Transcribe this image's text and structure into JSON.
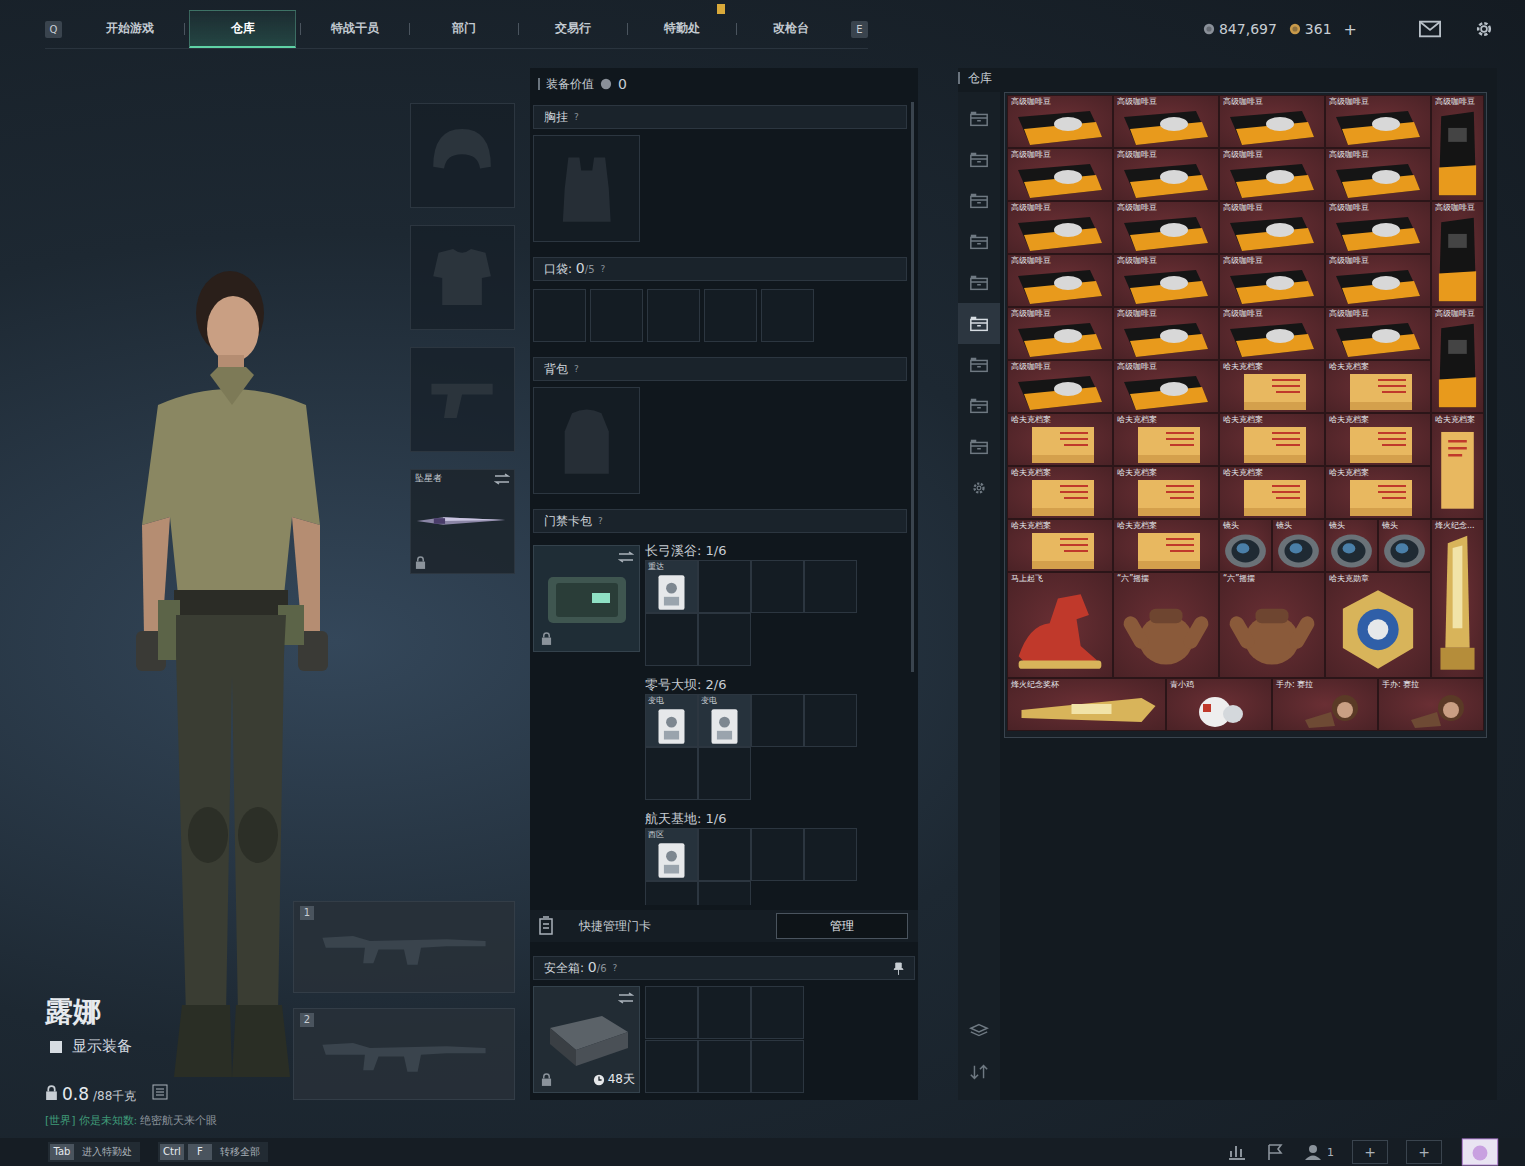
{
  "top_bar": {
    "prev_key": "Q",
    "next_key": "E",
    "tabs": [
      {
        "label": "开始游戏",
        "selected": false
      },
      {
        "label": "仓库",
        "selected": true
      },
      {
        "label": "特战干员",
        "selected": false
      },
      {
        "label": "部门",
        "selected": false
      },
      {
        "label": "交易行",
        "selected": false
      },
      {
        "label": "特勤处",
        "selected": false
      },
      {
        "label": "改枪台",
        "selected": false
      }
    ],
    "currency": [
      {
        "value": "847,697",
        "color": "#8a9099"
      },
      {
        "value": "361",
        "color": "#c99a4a"
      }
    ],
    "add": "+"
  },
  "character": {
    "name": "露娜",
    "show_gear": {
      "label": "显示装备",
      "checked": false
    },
    "weight": "0.8",
    "weight_max": "/88千克",
    "chat": {
      "channel": "[世界]",
      "user": "你是未知数:",
      "message": "绝密航天来个眼"
    }
  },
  "gear_slots": [
    {
      "kind": "helmet",
      "label": "",
      "locked": false
    },
    {
      "kind": "armor",
      "label": "",
      "locked": false
    },
    {
      "kind": "pistol",
      "label": "",
      "locked": false
    },
    {
      "kind": "melee",
      "label": "坠星者",
      "locked": true
    }
  ],
  "weapon_slots": [
    {
      "number": "1"
    },
    {
      "number": "2"
    }
  ],
  "loadout": {
    "title": "装备价值",
    "value": "0",
    "help": "?",
    "chest": "胸挂",
    "pockets": {
      "label": "口袋:",
      "used": "0",
      "capacity": "/5",
      "slots": 5
    },
    "backpack": "背包",
    "keycard": {
      "label": "门禁卡包",
      "locked": true,
      "groups": [
        {
          "map": "长弓溪谷: 1/6",
          "cards": [
            "重达"
          ]
        },
        {
          "map": "零号大坝: 2/6",
          "cards": [
            "变电",
            "变电"
          ]
        },
        {
          "map": "航天基地: 1/6",
          "cards": [
            "西区"
          ]
        }
      ]
    },
    "quick_manage": {
      "label": "快捷管理门卡",
      "button": "管理"
    },
    "safe": {
      "label": "安全箱:",
      "used": "0",
      "capacity": "/6",
      "timer": "48天",
      "locked": true
    }
  },
  "warehouse": {
    "title": "仓库",
    "tabs": [
      {
        "selected": false
      },
      {
        "selected": false
      },
      {
        "selected": false
      },
      {
        "selected": false
      },
      {
        "selected": false
      },
      {
        "selected": true
      },
      {
        "selected": false
      },
      {
        "selected": false
      },
      {
        "selected": false
      }
    ],
    "items": [
      {
        "kind": "coffee",
        "label": "高级咖啡豆"
      },
      {
        "kind": "coffee",
        "label": "高级咖啡豆"
      },
      {
        "kind": "coffee",
        "label": "高级咖啡豆"
      },
      {
        "kind": "coffee",
        "label": "高级咖啡豆"
      },
      {
        "kind": "coffee-tall",
        "label": "高级咖啡豆"
      },
      {
        "kind": "coffee",
        "label": "高级咖啡豆"
      },
      {
        "kind": "coffee",
        "label": "高级咖啡豆"
      },
      {
        "kind": "coffee",
        "label": "高级咖啡豆"
      },
      {
        "kind": "coffee",
        "label": "高级咖啡豆"
      },
      {
        "kind": "coffee",
        "label": "高级咖啡豆"
      },
      {
        "kind": "coffee",
        "label": "高级咖啡豆"
      },
      {
        "kind": "coffee",
        "label": "高级咖啡豆"
      },
      {
        "kind": "coffee",
        "label": "高级咖啡豆"
      },
      {
        "kind": "coffee-tall",
        "label": "高级咖啡豆"
      },
      {
        "kind": "coffee",
        "label": "高级咖啡豆"
      },
      {
        "kind": "coffee",
        "label": "高级咖啡豆"
      },
      {
        "kind": "coffee",
        "label": "高级咖啡豆"
      },
      {
        "kind": "coffee",
        "label": "高级咖啡豆"
      },
      {
        "kind": "coffee",
        "label": "高级咖啡豆"
      },
      {
        "kind": "coffee",
        "label": "高级咖啡豆"
      },
      {
        "kind": "coffee",
        "label": "高级咖啡豆"
      },
      {
        "kind": "coffee",
        "label": "高级咖啡豆"
      },
      {
        "kind": "coffee-tall",
        "label": "高级咖啡豆"
      },
      {
        "kind": "coffee",
        "label": "高级咖啡豆"
      },
      {
        "kind": "coffee",
        "label": "高级咖啡豆"
      },
      {
        "kind": "file",
        "label": "哈夫克档案"
      },
      {
        "kind": "file",
        "label": "哈夫克档案"
      },
      {
        "kind": "file",
        "label": "哈夫克档案"
      },
      {
        "kind": "file",
        "label": "哈夫克档案"
      },
      {
        "kind": "file",
        "label": "哈夫克档案"
      },
      {
        "kind": "file",
        "label": "哈夫克档案"
      },
      {
        "kind": "file-tall",
        "label": "哈夫克档案"
      },
      {
        "kind": "file",
        "label": "哈夫克档案"
      },
      {
        "kind": "file",
        "label": "哈夫克档案"
      },
      {
        "kind": "file",
        "label": "哈夫克档案"
      },
      {
        "kind": "file",
        "label": "哈夫克档案"
      },
      {
        "kind": "file",
        "label": "哈夫克档案"
      },
      {
        "kind": "file",
        "label": "哈夫克档案"
      },
      {
        "kind": "lens",
        "label": "镜头"
      },
      {
        "kind": "lens",
        "label": "镜头"
      },
      {
        "kind": "lens",
        "label": "镜头"
      },
      {
        "kind": "lens",
        "label": "镜头"
      },
      {
        "kind": "trophy-tall",
        "label": "烽火纪念..."
      },
      {
        "kind": "horse",
        "label": "马上起飞"
      },
      {
        "kind": "hand",
        "label": "“六”摇摆"
      },
      {
        "kind": "hand",
        "label": "“六”摇摆"
      },
      {
        "kind": "medal",
        "label": "哈夫克勋章"
      },
      {
        "kind": "trophy-long",
        "label": "烽火纪念奖杯"
      },
      {
        "kind": "chick",
        "label": "青小鸡"
      },
      {
        "kind": "figure",
        "label": "手办: 赛拉"
      },
      {
        "kind": "figure",
        "label": "手办: 赛拉"
      }
    ]
  },
  "bottom_bar": {
    "actions": [
      {
        "keys": [
          "Tab"
        ],
        "label": "进入特勤处"
      },
      {
        "keys": [
          "Ctrl",
          "F"
        ],
        "label": "转移全部"
      }
    ],
    "friends": "1",
    "add_buttons": [
      "+",
      "+"
    ]
  }
}
